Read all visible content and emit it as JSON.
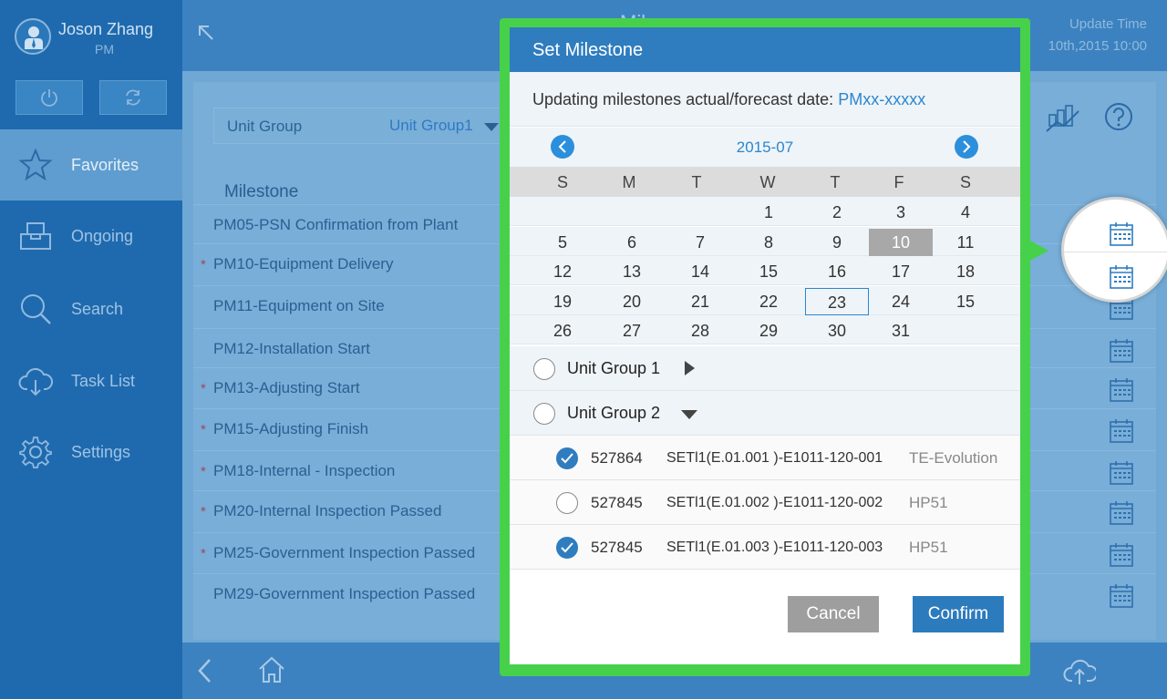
{
  "user": {
    "name": "Joson Zhang",
    "role": "PM"
  },
  "nav": [
    {
      "label": "Favorites",
      "icon": "star-icon",
      "active": true
    },
    {
      "label": "Ongoing",
      "icon": "inbox-icon",
      "active": false
    },
    {
      "label": "Search",
      "icon": "search-icon",
      "active": false
    },
    {
      "label": "Task List",
      "icon": "cloud-download-icon",
      "active": false
    },
    {
      "label": "Settings",
      "icon": "gear-icon",
      "active": false
    }
  ],
  "topbar": {
    "title": "Mil…",
    "update_label": "Update Time",
    "update_value": "10th,2015 10:00"
  },
  "filter": {
    "label": "Unit Group",
    "value": "Unit Group1"
  },
  "milestone_header": "Milestone",
  "milestones": [
    {
      "label": "PM05-PSN Confirmation from Plant",
      "required": false
    },
    {
      "label": "PM10-Equipment Delivery",
      "required": true
    },
    {
      "label": "PM11-Equipment on Site",
      "required": false
    },
    {
      "label": "PM12-Installation Start",
      "required": false
    },
    {
      "label": "PM13-Adjusting Start",
      "required": true
    },
    {
      "label": "PM15-Adjusting Finish",
      "required": true
    },
    {
      "label": "PM18-Internal - Inspection",
      "required": true
    },
    {
      "label": "PM20-Internal Inspection Passed",
      "required": true
    },
    {
      "label": "PM25-Government Inspection Passed",
      "required": true
    },
    {
      "label": "PM29-Government Inspection Passed",
      "required": false
    }
  ],
  "modal": {
    "title": "Set Milestone",
    "subtitle_prefix": "Updating milestones actual/forecast date: ",
    "subtitle_code": "PMxx-xxxxx",
    "month": "2015-07",
    "weekdays": [
      "S",
      "M",
      "T",
      "W",
      "T",
      "F",
      "S"
    ],
    "weeks": [
      [
        "",
        "",
        "",
        "1",
        "2",
        "3",
        "4"
      ],
      [
        "5",
        "6",
        "7",
        "8",
        "9",
        "10",
        "11"
      ],
      [
        "12",
        "13",
        "14",
        "15",
        "16",
        "17",
        "18"
      ],
      [
        "19",
        "20",
        "21",
        "22",
        "23",
        "24",
        "15"
      ],
      [
        "26",
        "27",
        "28",
        "29",
        "30",
        "31",
        ""
      ]
    ],
    "selected_day": "10",
    "today_day": "23",
    "unit_groups": [
      {
        "label": "Unit Group 1",
        "expanded": false
      },
      {
        "label": "Unit Group 2",
        "expanded": true
      }
    ],
    "units": [
      {
        "number": "527864",
        "code": "SETl1(E.01.001 )-E1011-120-001",
        "model": "TE-Evolution",
        "checked": true
      },
      {
        "number": "527845",
        "code": "SETl1(E.01.002 )-E1011-120-002",
        "model": "HP51",
        "checked": false
      },
      {
        "number": "527845",
        "code": "SETl1(E.01.003 )-E1011-120-003",
        "model": "HP51",
        "checked": true
      }
    ],
    "cancel_label": "Cancel",
    "confirm_label": "Confirm"
  },
  "colors": {
    "sidebar": "#1f6aae",
    "accent": "#2f7dbf",
    "highlight_frame": "#47d14b",
    "link": "#2c86cf"
  }
}
